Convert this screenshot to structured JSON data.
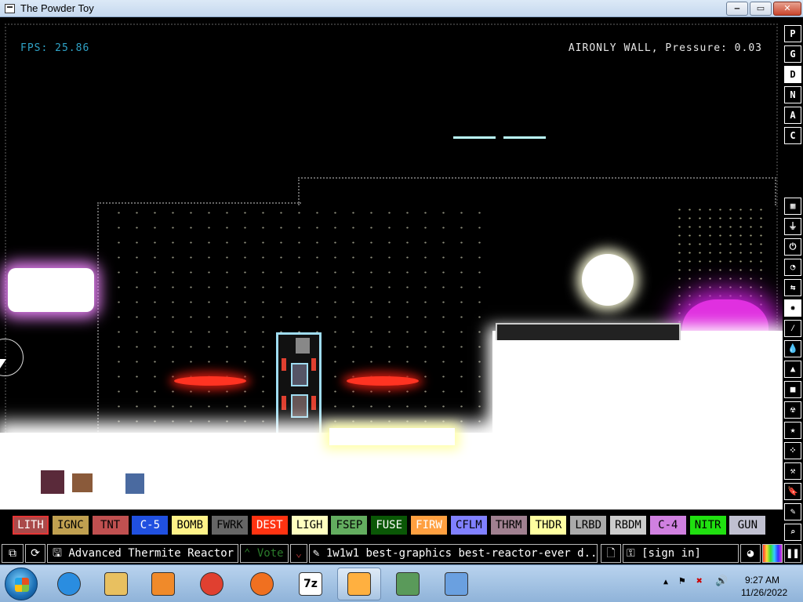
{
  "window": {
    "title": "The Powder Toy",
    "min_label": "‒",
    "max_label": "▭",
    "close_label": "✕"
  },
  "hud": {
    "fps": "FPS: 25.86",
    "hover_info": "AIRONLY WALL, Pressure: 0.03"
  },
  "side_menu": {
    "top": [
      {
        "label": "P",
        "active": false
      },
      {
        "label": "G",
        "active": false
      },
      {
        "label": "D",
        "active": true
      },
      {
        "label": "N",
        "active": false
      },
      {
        "label": "A",
        "active": false
      },
      {
        "label": "C",
        "active": false
      }
    ],
    "categories": [
      {
        "icon": "walls-icon",
        "glyph": "▦"
      },
      {
        "icon": "electronics-icon",
        "glyph": "⏚"
      },
      {
        "icon": "powered-icon",
        "glyph": "⏻"
      },
      {
        "icon": "sensors-icon",
        "glyph": "◔"
      },
      {
        "icon": "force-icon",
        "glyph": "⇆"
      },
      {
        "icon": "explosives-icon",
        "glyph": "✸",
        "active": true
      },
      {
        "icon": "gases-icon",
        "glyph": "⁄"
      },
      {
        "icon": "liquids-icon",
        "glyph": "💧"
      },
      {
        "icon": "powders-icon",
        "glyph": "▲"
      },
      {
        "icon": "solids-icon",
        "glyph": "■"
      },
      {
        "icon": "radioactive-icon",
        "glyph": "☢"
      },
      {
        "icon": "special-icon",
        "glyph": "★"
      },
      {
        "icon": "game-of-life-icon",
        "glyph": "⁘"
      },
      {
        "icon": "tools-icon",
        "glyph": "⚒"
      },
      {
        "icon": "favorites-icon",
        "glyph": "🔖"
      },
      {
        "icon": "decoration-icon",
        "glyph": "✎"
      },
      {
        "icon": "search-icon",
        "glyph": "⌕"
      }
    ]
  },
  "elements": [
    {
      "label": "LITH",
      "bg": "#aa4a4a",
      "fg": "#ffffff",
      "selected": true
    },
    {
      "label": "IGNC",
      "bg": "#c0a050",
      "fg": "#000000"
    },
    {
      "label": "TNT",
      "bg": "#c05050",
      "fg": "#000000"
    },
    {
      "label": "C-5",
      "bg": "#2050e0",
      "fg": "#ffffff"
    },
    {
      "label": "BOMB",
      "bg": "#fff288",
      "fg": "#000000"
    },
    {
      "label": "FWRK",
      "bg": "#666666",
      "fg": "#000000"
    },
    {
      "label": "DEST",
      "bg": "#ff3311",
      "fg": "#ffffff"
    },
    {
      "label": "LIGH",
      "bg": "#ffffc0",
      "fg": "#000000"
    },
    {
      "label": "FSEP",
      "bg": "#63ad5f",
      "fg": "#000000"
    },
    {
      "label": "FUSE",
      "bg": "#0a5706",
      "fg": "#ffffff"
    },
    {
      "label": "FIRW",
      "bg": "#ffa040",
      "fg": "#ffffff"
    },
    {
      "label": "CFLM",
      "bg": "#8080ff",
      "fg": "#000000"
    },
    {
      "label": "THRM",
      "bg": "#a08090",
      "fg": "#000000"
    },
    {
      "label": "THDR",
      "bg": "#ffffa0",
      "fg": "#000000"
    },
    {
      "label": "LRBD",
      "bg": "#aaaaaa",
      "fg": "#000000"
    },
    {
      "label": "RBDM",
      "bg": "#cccccc",
      "fg": "#000000"
    },
    {
      "label": "C-4",
      "bg": "#d080e0",
      "fg": "#000000"
    },
    {
      "label": "NITR",
      "bg": "#20e010",
      "fg": "#000000"
    },
    {
      "label": "GUN",
      "bg": "#c0c0d0",
      "fg": "#000000"
    }
  ],
  "bottom_bar": {
    "save_title": "Advanced Thermite Reactor",
    "vote_label": "Vote",
    "tags": "1w1w1 best-graphics best-reactor-ever d...",
    "sign_in": "[sign in]"
  },
  "taskbar": {
    "time": "9:27 AM",
    "date": "11/26/2022",
    "apps": [
      {
        "name": "internet-explorer"
      },
      {
        "name": "file-explorer"
      },
      {
        "name": "media-player"
      },
      {
        "name": "chrome"
      },
      {
        "name": "firefox"
      },
      {
        "name": "7zip",
        "label": "7z"
      },
      {
        "name": "powder-toy",
        "active": true
      },
      {
        "name": "network-app"
      },
      {
        "name": "control-panel"
      }
    ]
  },
  "colors": {
    "fps": "#2fa3c7",
    "selected_border": "#e63535"
  }
}
